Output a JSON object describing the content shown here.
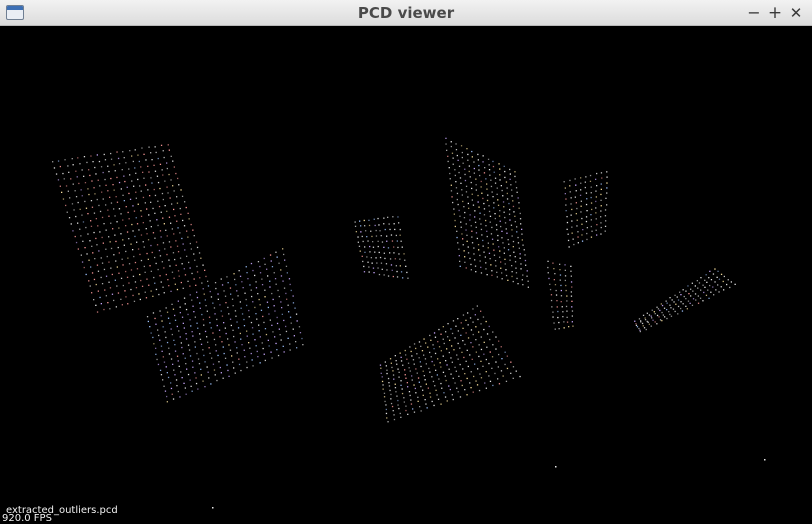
{
  "window": {
    "title": "PCD viewer",
    "controls": {
      "minimize": "−",
      "maximize": "+",
      "close": "✕"
    }
  },
  "viewer": {
    "background": "#000000",
    "cloud_name": "extracted_outliers.pcd",
    "fps": "920.0 FPS",
    "point_colors": [
      "#e8e8e8",
      "#c9a9ff",
      "#ff9a9a",
      "#9ec3ff",
      "#ffe6a0"
    ]
  },
  "icons": {
    "app": "window-app-icon",
    "minimize": "minimize-icon",
    "maximize": "maximize-icon",
    "close": "close-icon"
  }
}
